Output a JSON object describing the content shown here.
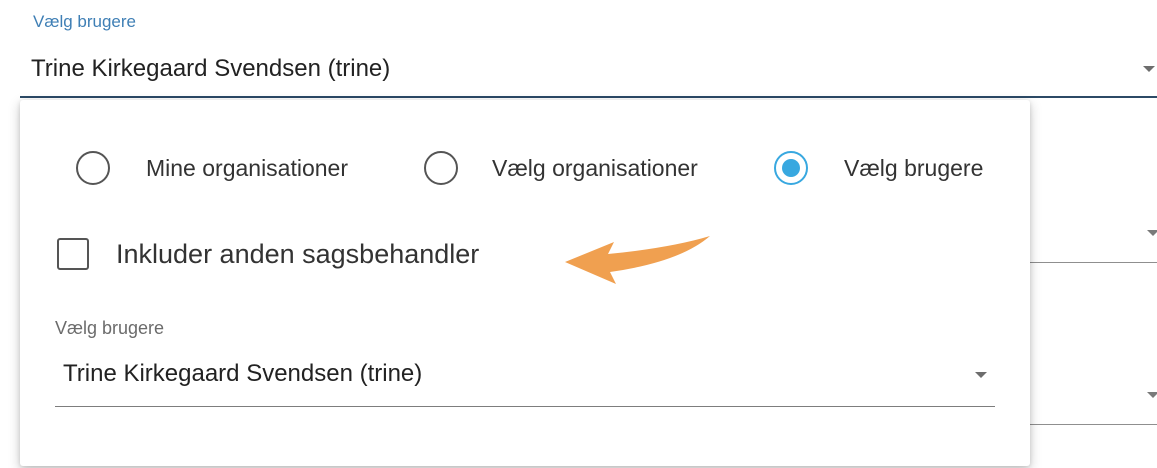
{
  "top_select": {
    "label": "Vælg brugere",
    "value": "Trine Kirkegaard Svendsen (trine)"
  },
  "panel": {
    "radio_options": [
      {
        "label": "Mine organisationer",
        "checked": false
      },
      {
        "label": "Vælg organisationer",
        "checked": false
      },
      {
        "label": "Vælg brugere",
        "checked": true
      }
    ],
    "checkbox": {
      "label": "Inkluder anden sagsbehandler",
      "checked": false
    },
    "user_select": {
      "label": "Vælg brugere",
      "value": "Trine Kirkegaard Svendsen (trine)"
    }
  },
  "colors": {
    "accent": "#38a8e0",
    "arrow": "#f0a050",
    "label_blue": "#3f7fb5"
  },
  "annotation": {
    "icon": "orange-arrow-icon"
  }
}
